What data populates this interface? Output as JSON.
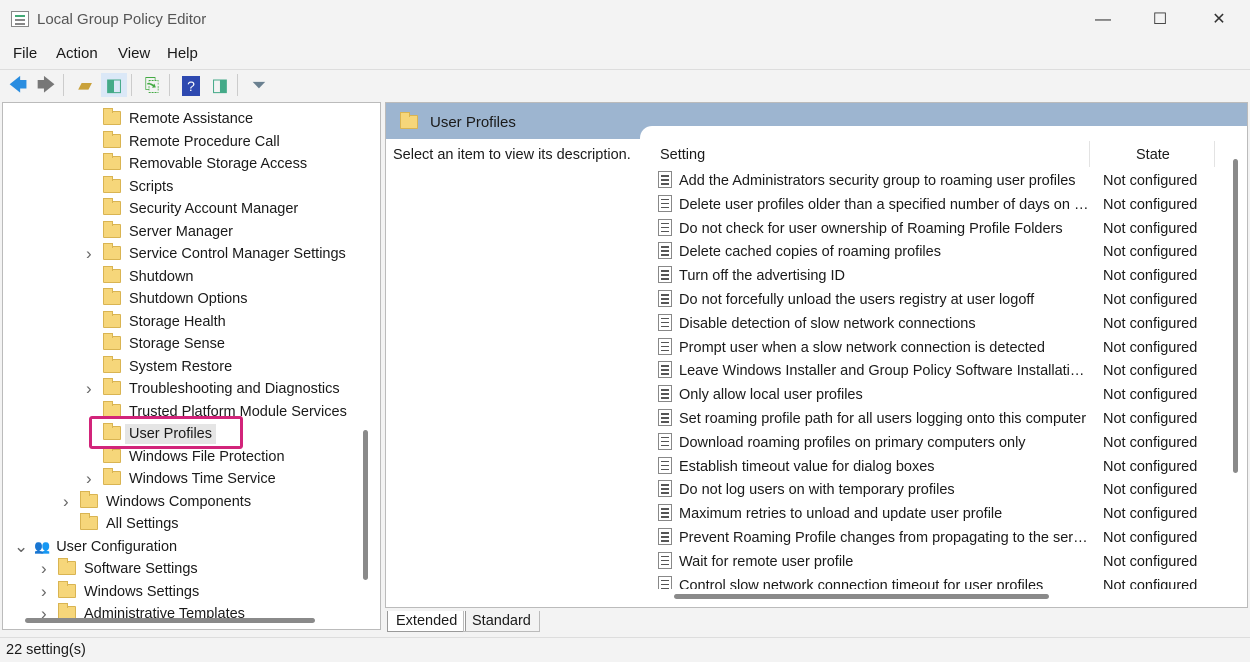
{
  "window": {
    "title": "Local Group Policy Editor",
    "minimize": "—",
    "maximize": "☐",
    "close": "✕"
  },
  "menu": [
    "File",
    "Action",
    "View",
    "Help"
  ],
  "toolbar": [
    "back-icon",
    "forward-icon",
    "up-folder-icon",
    "show-hide-tree-icon",
    "export-list-icon",
    "help-icon",
    "show-hide-action-pane-icon",
    "filter-icon"
  ],
  "tree": [
    {
      "label": "Remote Assistance",
      "level": 3,
      "expand": false
    },
    {
      "label": "Remote Procedure Call",
      "level": 3,
      "expand": false
    },
    {
      "label": "Removable Storage Access",
      "level": 3,
      "expand": false
    },
    {
      "label": "Scripts",
      "level": 3,
      "expand": false
    },
    {
      "label": "Security Account Manager",
      "level": 3,
      "expand": false
    },
    {
      "label": "Server Manager",
      "level": 3,
      "expand": false
    },
    {
      "label": "Service Control Manager Settings",
      "level": 3,
      "expand": true
    },
    {
      "label": "Shutdown",
      "level": 3,
      "expand": false
    },
    {
      "label": "Shutdown Options",
      "level": 3,
      "expand": false
    },
    {
      "label": "Storage Health",
      "level": 3,
      "expand": false
    },
    {
      "label": "Storage Sense",
      "level": 3,
      "expand": false
    },
    {
      "label": "System Restore",
      "level": 3,
      "expand": false
    },
    {
      "label": "Troubleshooting and Diagnostics",
      "level": 3,
      "expand": true
    },
    {
      "label": "Trusted Platform Module Services",
      "level": 3,
      "expand": false
    },
    {
      "label": "User Profiles",
      "level": 3,
      "expand": false,
      "selected": true
    },
    {
      "label": "Windows File Protection",
      "level": 3,
      "expand": false
    },
    {
      "label": "Windows Time Service",
      "level": 3,
      "expand": true
    },
    {
      "label": "Windows Components",
      "level": 2,
      "expand": true
    },
    {
      "label": "All Settings",
      "level": 2,
      "expand": false,
      "icon": "all-settings-icon"
    },
    {
      "label": "User Configuration",
      "level": 0,
      "expand": "open",
      "icon": "user-config-icon"
    },
    {
      "label": "Software Settings",
      "level": 1,
      "expand": true
    },
    {
      "label": "Windows Settings",
      "level": 1,
      "expand": true
    },
    {
      "label": "Administrative Templates",
      "level": 1,
      "expand": true
    }
  ],
  "right": {
    "header": "User Profiles",
    "description": "Select an item to view its description.",
    "columns": {
      "setting": "Setting",
      "state": "State"
    },
    "rows": [
      {
        "name": "Add the Administrators security group to roaming user profiles",
        "state": "Not configured"
      },
      {
        "name": "Delete user profiles older than a specified number of days on system restart",
        "state": "Not configured"
      },
      {
        "name": "Do not check for user ownership of Roaming Profile Folders",
        "state": "Not configured"
      },
      {
        "name": "Delete cached copies of roaming profiles",
        "state": "Not configured"
      },
      {
        "name": "Turn off the advertising ID",
        "state": "Not configured"
      },
      {
        "name": "Do not forcefully unload the users registry at user logoff",
        "state": "Not configured"
      },
      {
        "name": "Disable detection of slow network connections",
        "state": "Not configured"
      },
      {
        "name": "Prompt user when a slow network connection is detected",
        "state": "Not configured"
      },
      {
        "name": "Leave Windows Installer and Group Policy Software Installation Data",
        "state": "Not configured"
      },
      {
        "name": "Only allow local user profiles",
        "state": "Not configured"
      },
      {
        "name": "Set roaming profile path for all users logging onto this computer",
        "state": "Not configured"
      },
      {
        "name": "Download roaming profiles on primary computers only",
        "state": "Not configured"
      },
      {
        "name": "Establish timeout value for dialog boxes",
        "state": "Not configured"
      },
      {
        "name": "Do not log users on with temporary profiles",
        "state": "Not configured"
      },
      {
        "name": "Maximum retries to unload and update user profile",
        "state": "Not configured"
      },
      {
        "name": "Prevent Roaming Profile changes from propagating to the server",
        "state": "Not configured"
      },
      {
        "name": "Wait for remote user profile",
        "state": "Not configured"
      },
      {
        "name": "Control slow network connection timeout for user profiles",
        "state": "Not configured"
      }
    ]
  },
  "tabs": [
    "Extended",
    "Standard"
  ],
  "status": "22 setting(s)",
  "colors": {
    "highlight": "#d2247a",
    "header": "#9db5d0",
    "folder": "#f6d67a"
  }
}
